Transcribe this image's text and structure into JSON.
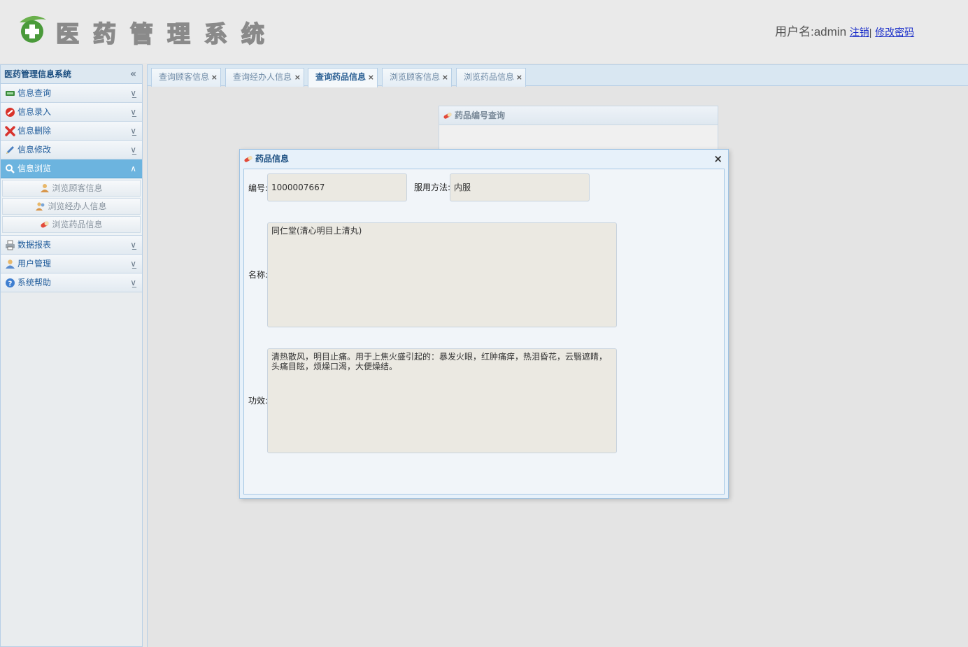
{
  "header": {
    "logo_text": "医药管理系统",
    "username_label": "用户名:admin",
    "logout_link": "注销",
    "separator": "|",
    "change_password_link": "修改密码"
  },
  "sidebar": {
    "title": "医药管理信息系统",
    "collapse_glyph": "«",
    "items": [
      {
        "label": "信息查询",
        "icon": "card-icon"
      },
      {
        "label": "信息录入",
        "icon": "no-entry-icon"
      },
      {
        "label": "信息删除",
        "icon": "red-x-icon"
      },
      {
        "label": "信息修改",
        "icon": "pencil-icon"
      },
      {
        "label": "信息浏览",
        "icon": "magnifier-icon"
      },
      {
        "label": "数据报表",
        "icon": "printer-icon"
      },
      {
        "label": "用户管理",
        "icon": "user-icon"
      },
      {
        "label": "系统帮助",
        "icon": "help-icon"
      }
    ],
    "sub_items": [
      {
        "label": "浏览顾客信息",
        "icon": "customer-icon"
      },
      {
        "label": "浏览经办人信息",
        "icon": "agent-icon"
      },
      {
        "label": "浏览药品信息",
        "icon": "pill-icon"
      }
    ]
  },
  "tabs": [
    {
      "label": "查询顾客信息",
      "active": false
    },
    {
      "label": "查询经办人信息",
      "active": false
    },
    {
      "label": "查询药品信息",
      "active": true
    },
    {
      "label": "浏览顾客信息",
      "active": false
    },
    {
      "label": "浏览药品信息",
      "active": false
    }
  ],
  "tab_close_glyph": "×",
  "background_panel": {
    "title": "药品编号查询"
  },
  "modal": {
    "title": "药品信息",
    "close_glyph": "×",
    "fields": {
      "id_label": "编号:",
      "id_value": "1000007667",
      "usage_label": "服用方法:",
      "usage_value": "内服",
      "name_label": "名称:",
      "name_value": "同仁堂(清心明目上清丸)",
      "effect_label": "功效:",
      "effect_value": "清热散风，明目止痛。用于上焦火盛引起的：暴发火眼，红肿痛痒，热泪昏花，云翳遮睛，头痛目眩，烦燥口渴，大便燥结。"
    }
  },
  "colors": {
    "active_menu": "#6cb4df",
    "link": "#1b2fc9",
    "field_bg": "#ebe9e2",
    "modal_border": "#9ec2e2"
  }
}
